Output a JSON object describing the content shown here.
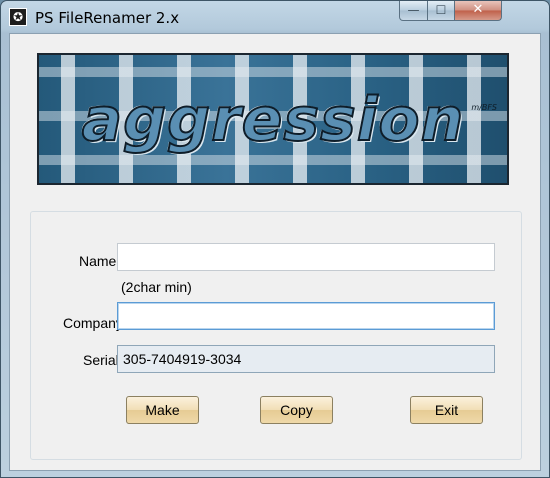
{
  "window": {
    "title": "PS FileRenamer 2.x",
    "app_icon_glyph": "✪",
    "controls": {
      "minimize": "—",
      "maximize": "☐",
      "close": "✕"
    }
  },
  "banner": {
    "art_text": "aggression",
    "signature": "m/BFS"
  },
  "form": {
    "name_label": "Name",
    "name_value": "",
    "name_hint": "(2char min)",
    "company_label": "Company",
    "company_value": "",
    "serial_label": "Serial",
    "serial_value": "305-7404919-3034"
  },
  "buttons": {
    "make": "Make",
    "copy": "Copy",
    "exit": "Exit"
  },
  "colors": {
    "button_face": "#efd9a9",
    "focus_border": "#5b9bd5",
    "close_button": "#c0604a"
  }
}
